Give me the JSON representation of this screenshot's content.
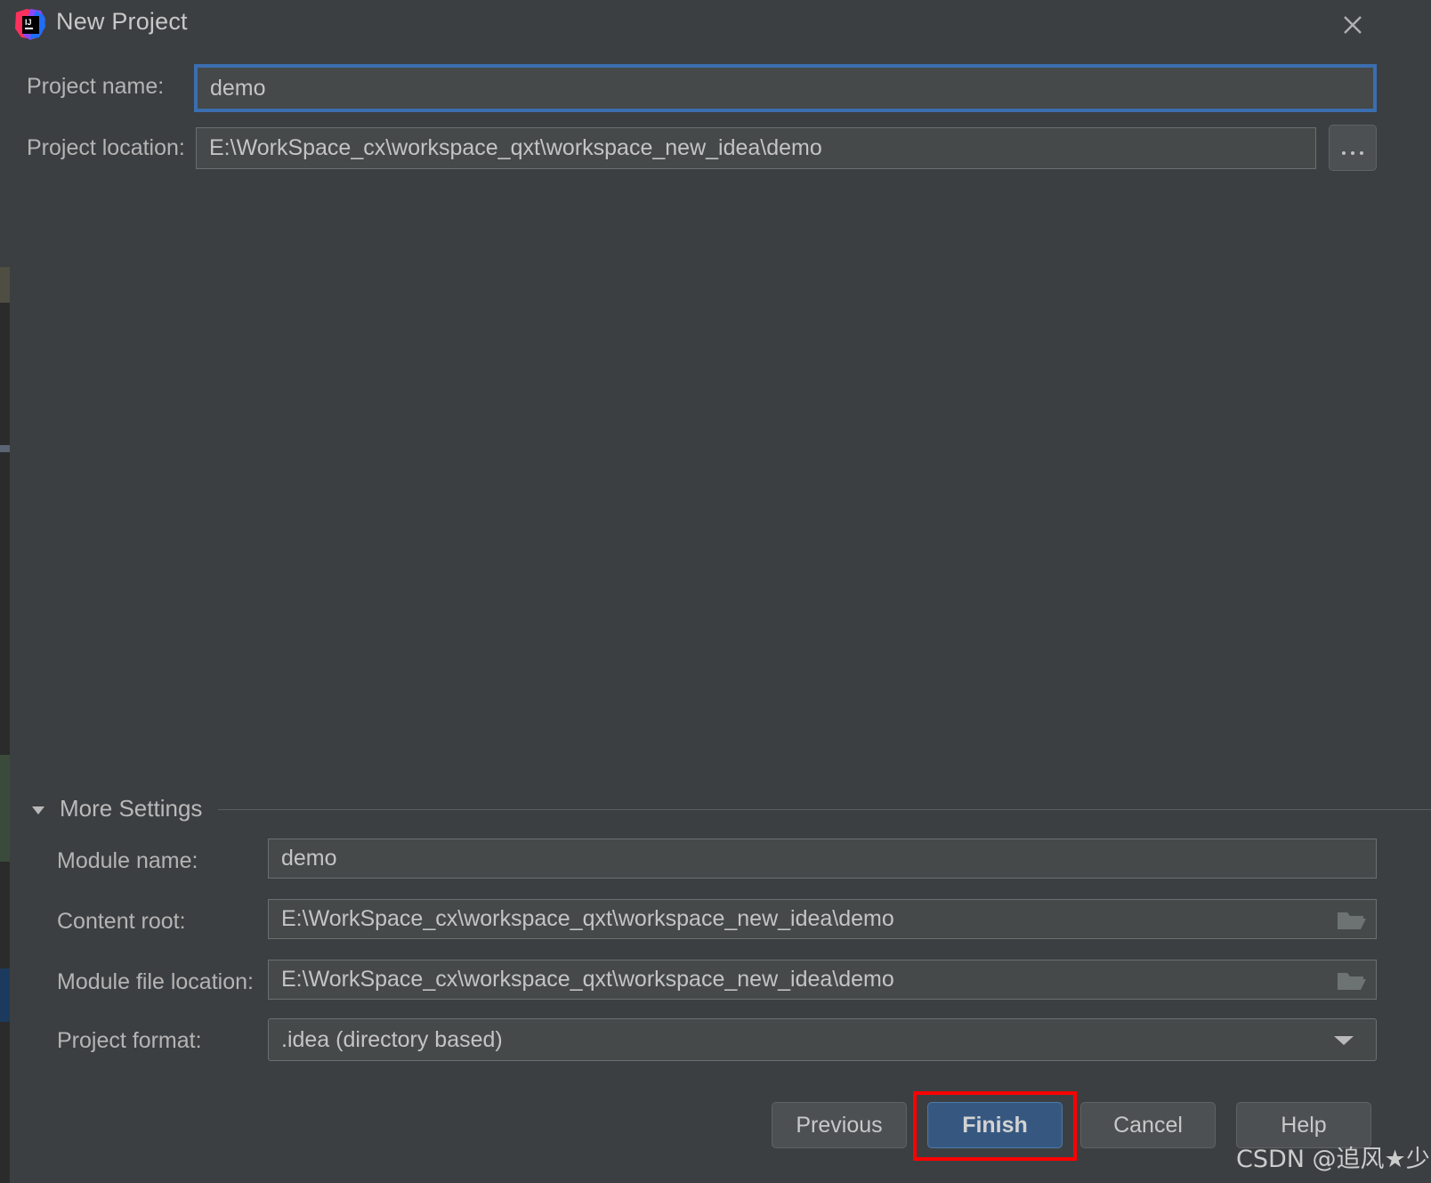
{
  "window": {
    "title": "New Project",
    "logo_icon": "intellij-idea-logo",
    "close_icon": "close-icon"
  },
  "form": {
    "project_name": {
      "label": "Project name:",
      "value": "demo"
    },
    "project_location": {
      "label": "Project location:",
      "value": "E:\\WorkSpace_cx\\workspace_qxt\\workspace_new_idea\\demo",
      "browse_label": "...",
      "browse_icon": "ellipsis-icon"
    }
  },
  "more_settings": {
    "label": "More Settings",
    "expanded": true,
    "toggle_icon": "triangle-down-icon",
    "module_name": {
      "label": "Module name:",
      "value": "demo"
    },
    "content_root": {
      "label": "Content root:",
      "value": "E:\\WorkSpace_cx\\workspace_qxt\\workspace_new_idea\\demo",
      "browse_icon": "folder-icon"
    },
    "module_file_location": {
      "label": "Module file location:",
      "value": "E:\\WorkSpace_cx\\workspace_qxt\\workspace_new_idea\\demo",
      "browse_icon": "folder-icon"
    },
    "project_format": {
      "label": "Project format:",
      "value": ".idea (directory based)",
      "dropdown_icon": "chevron-down-icon",
      "options": [
        ".idea (directory based)"
      ]
    }
  },
  "buttons": {
    "previous": "Previous",
    "finish": "Finish",
    "cancel": "Cancel",
    "help": "Help"
  },
  "annotation": {
    "highlight_color": "#ff0000",
    "target": "finish-button"
  },
  "watermark": {
    "text": "CSDN @追风★少年"
  },
  "colors": {
    "dialog_background": "#3c3f41",
    "field_background": "#45494a",
    "field_border": "#6b6f70",
    "focus_border": "#3b6eaf",
    "primary_button": "#365880",
    "text": "#b4b4b4"
  }
}
